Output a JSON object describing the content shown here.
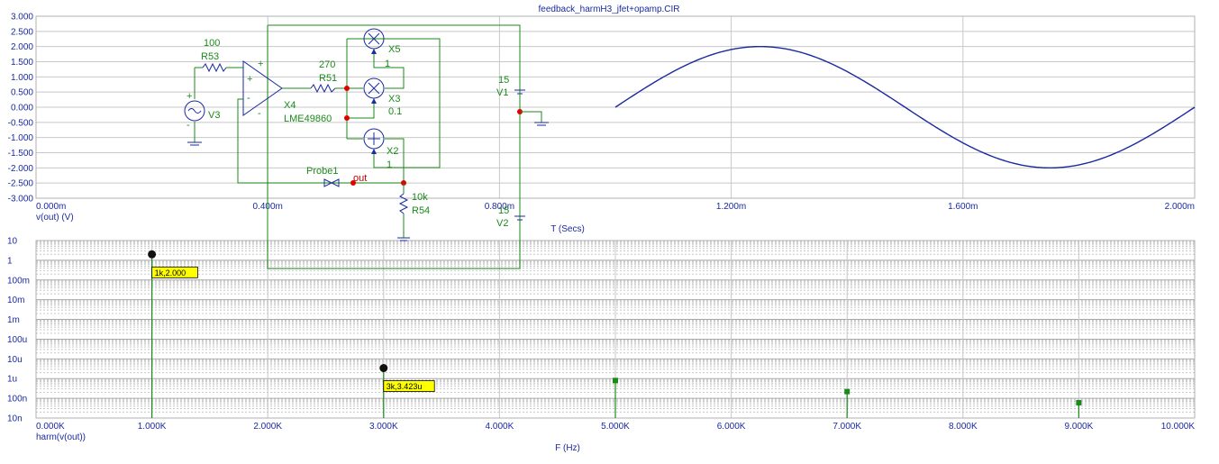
{
  "window": {
    "title": "feedback_harmH3_jfet+opamp.CIR"
  },
  "colors": {
    "frame": "#b0b0b0",
    "grid": "#c8c8c8",
    "trace": "#1a2aa0",
    "harmonic": "#1a8a1a",
    "schematic_wire": "#1a8a1a",
    "schematic_symbol": "#1a2aa0",
    "label_bg": "#ffff00"
  },
  "chart_data": [
    {
      "type": "line",
      "name": "top-transient",
      "title": "feedback_harmH3_jfet+opamp.CIR",
      "xlabel": "T (Secs)",
      "ylabel": "v(out) (V)",
      "xlim": [
        0,
        0.002
      ],
      "ylim": [
        -3,
        3
      ],
      "x_ticks": [
        0,
        0.0004,
        0.0008,
        0.0012,
        0.0016,
        0.002
      ],
      "x_tick_labels": [
        "0.000m",
        "0.400m",
        "0.800m",
        "1.200m",
        "1.600m",
        "2.000m"
      ],
      "y_ticks": [
        3,
        2.5,
        2,
        1.5,
        1,
        0.5,
        0,
        -0.5,
        -1,
        -1.5,
        -2,
        -2.5,
        -3
      ],
      "y_tick_labels": [
        "3.000",
        "2.500",
        "2.000",
        "1.500",
        "1.000",
        "0.500",
        "0.000",
        "-0.500",
        "-1.000",
        "-1.500",
        "-2.000",
        "-2.500",
        "-3.000"
      ],
      "series": [
        {
          "amplitude": 2.0,
          "frequency_hz": 1000,
          "x_start": 0.001,
          "x_end": 0.002
        }
      ],
      "grid": true
    },
    {
      "type": "bar",
      "name": "bottom-harmonics",
      "xlabel": "F (Hz)",
      "ylabel": "harm(v(out))",
      "scale_y": "log",
      "xlim": [
        0,
        10000
      ],
      "ylim": [
        1e-08,
        10
      ],
      "x_ticks": [
        0,
        1000,
        2000,
        3000,
        4000,
        5000,
        6000,
        7000,
        8000,
        9000,
        10000
      ],
      "x_tick_labels": [
        "0.000K",
        "1.000K",
        "2.000K",
        "3.000K",
        "4.000K",
        "5.000K",
        "6.000K",
        "7.000K",
        "8.000K",
        "9.000K",
        "10.000K"
      ],
      "y_ticks": [
        10,
        1,
        0.1,
        0.01,
        0.001,
        0.0001,
        1e-05,
        1e-06,
        1e-07,
        1e-08
      ],
      "y_tick_labels": [
        "10",
        "1",
        "100m",
        "10m",
        "1m",
        "100u",
        "10u",
        "1u",
        "100n",
        "10n"
      ],
      "x": [
        1000,
        3000,
        5000,
        7000,
        9000
      ],
      "values": [
        2.0,
        3.423e-06,
        8e-07,
        2.2e-07,
        6e-08
      ],
      "annotations": [
        {
          "x": 1000,
          "y": 2.0,
          "text": "1k,2.000"
        },
        {
          "x": 3000,
          "y": 3.423e-06,
          "text": "3k,3.423u"
        }
      ],
      "grid": true
    }
  ],
  "schematic": {
    "labels": {
      "r53_value": "100",
      "r53_name": "R53",
      "v3_name": "V3",
      "x4_name": "X4",
      "x4_part": "LME49860",
      "r51_value": "270",
      "r51_name": "R51",
      "x5_name": "X5",
      "x5_value": "1",
      "x3_name": "X3",
      "x3_value": "0.1",
      "x2_name": "X2",
      "x2_value": "1",
      "v1_value": "15",
      "v1_name": "V1",
      "v2_value": "15",
      "v2_name": "V2",
      "probe_name": "Probe1",
      "out_label": "out",
      "r54_value": "10k",
      "r54_name": "R54",
      "plus1": "+",
      "minus1": "-",
      "plus2": "+",
      "minus2": "-",
      "plus3": "+",
      "minus3": "-"
    }
  }
}
